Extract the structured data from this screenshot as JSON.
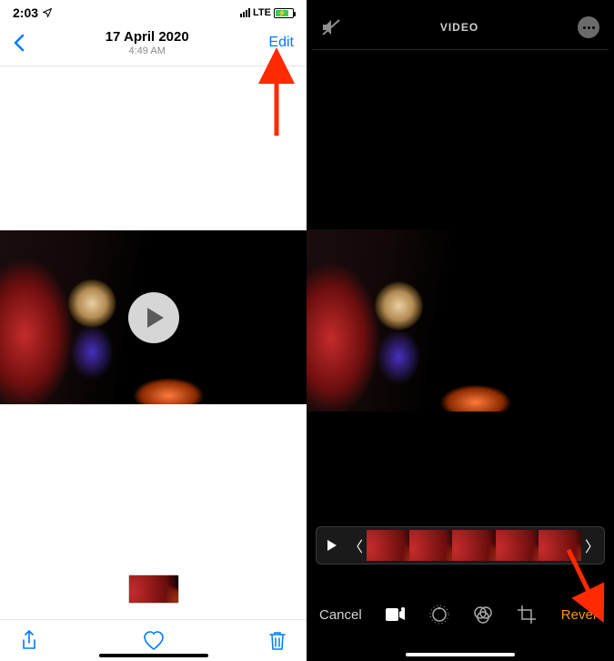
{
  "left": {
    "status_time": "2:03",
    "lte_label": "LTE",
    "nav": {
      "date": "17 April 2020",
      "time": "4:49 AM",
      "edit": "Edit"
    }
  },
  "right": {
    "title": "VIDEO",
    "cancel": "Cancel",
    "revert": "Revert"
  }
}
